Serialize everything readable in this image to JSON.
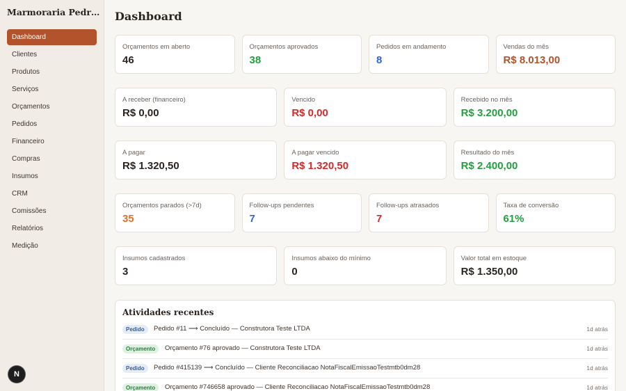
{
  "brand": "Marmoraria Pedra Nobre",
  "nav": [
    "Dashboard",
    "Clientes",
    "Produtos",
    "Serviços",
    "Orçamentos",
    "Pedidos",
    "Financeiro",
    "Compras",
    "Insumos",
    "CRM",
    "Comissões",
    "Relatórios",
    "Medição"
  ],
  "nav_active": "Dashboard",
  "badge": "N",
  "page_title": "Dashboard",
  "cards": [
    {
      "label": "Orçamentos em aberto",
      "value": "46",
      "color": "#2b2522"
    },
    {
      "label": "Orçamentos aprovados",
      "value": "38",
      "color": "#23a03f"
    },
    {
      "label": "Pedidos em andamento",
      "value": "8",
      "color": "#2f66d6"
    },
    {
      "label": "Vendas do mês",
      "value": "R$ 8.013,00",
      "color": "#b2532c"
    },
    {
      "label": "A receber (financeiro)",
      "value": "R$ 0,00",
      "color": "#2b2522"
    },
    {
      "label": "Vencido",
      "value": "R$ 0,00",
      "color": "#d42a2a"
    },
    {
      "label": "Recebido no mês",
      "value": "R$ 3.200,00",
      "color": "#23a03f"
    },
    {
      "label": "A pagar",
      "value": "R$ 1.320,50",
      "color": "#2b2522"
    },
    {
      "label": "A pagar vencido",
      "value": "R$ 1.320,50",
      "color": "#d42a2a"
    },
    {
      "label": "Resultado do mês",
      "value": "R$ 2.400,00",
      "color": "#23a03f"
    },
    {
      "label": "Orçamentos parados (>7d)",
      "value": "35",
      "color": "#e0702a"
    },
    {
      "label": "Follow-ups pendentes",
      "value": "7",
      "color": "#2f66d6"
    },
    {
      "label": "Follow-ups atrasados",
      "value": "7",
      "color": "#d42a2a"
    },
    {
      "label": "Taxa de conversão",
      "value": "61%",
      "color": "#23a03f"
    },
    {
      "label": "Insumos cadastrados",
      "value": "3",
      "color": "#2b2522"
    },
    {
      "label": "Insumos abaixo do mínimo",
      "value": "0",
      "color": "#2b2522"
    },
    {
      "label": "Valor total em estoque",
      "value": "R$ 1.350,00",
      "color": "#2b2522"
    }
  ],
  "activity": {
    "title": "Atividades recentes",
    "items": [
      {
        "tag": "Pedido",
        "type": "pedido",
        "text": "Pedido #11 ⟶ Concluído — Construtora Teste LTDA",
        "time": "1d atrás"
      },
      {
        "tag": "Orçamento",
        "type": "orc",
        "text": "Orçamento #76 aprovado — Construtora Teste LTDA",
        "time": "1d atrás"
      },
      {
        "tag": "Pedido",
        "type": "pedido",
        "text": "Pedido #415139 ⟶ Concluído — Cliente Reconciliacao NotaFiscalEmissaoTestmtb0dm28",
        "time": "1d atrás"
      },
      {
        "tag": "Orçamento",
        "type": "orc",
        "text": "Orçamento #746658 aprovado — Cliente Reconciliacao NotaFiscalEmissaoTestmtb0dm28",
        "time": "1d atrás"
      }
    ]
  }
}
